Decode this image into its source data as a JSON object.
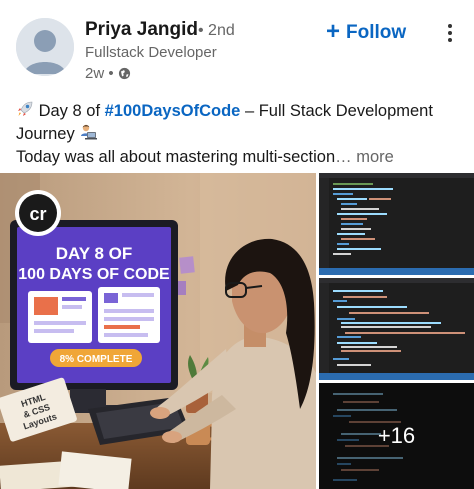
{
  "author": {
    "name": "Priya Jangid",
    "degree": "• 2nd",
    "headline": "Fullstack Developer",
    "time": "2w •",
    "visibility_icon": "globe-icon"
  },
  "actions": {
    "follow_label": "Follow",
    "follow_icon": "plus-icon",
    "more_icon": "vertical-ellipsis-icon"
  },
  "post": {
    "line1_pre": " Day 8 of ",
    "hashtag": "#100DaysOfCode",
    "line1_post": " – Full Stack Development",
    "line2": "Journey ",
    "line3": "Today was all about mastering multi-section",
    "see_more": "… more"
  },
  "media": {
    "main_image": {
      "badge": "cr",
      "screen_line1": "DAY 8 OF",
      "screen_line2": "100 DAYS OF CODE",
      "progress_label": "8% COMPLETE",
      "notebook_line1": "HTML",
      "notebook_line2": "& CSS",
      "notebook_line3": "Layouts"
    },
    "more_count": "+16"
  },
  "colors": {
    "accent": "#0a66c2",
    "text_primary": "#191919",
    "text_secondary": "#666666",
    "screen_purple": "#5b3fc4",
    "progress_orange": "#f0a637"
  }
}
